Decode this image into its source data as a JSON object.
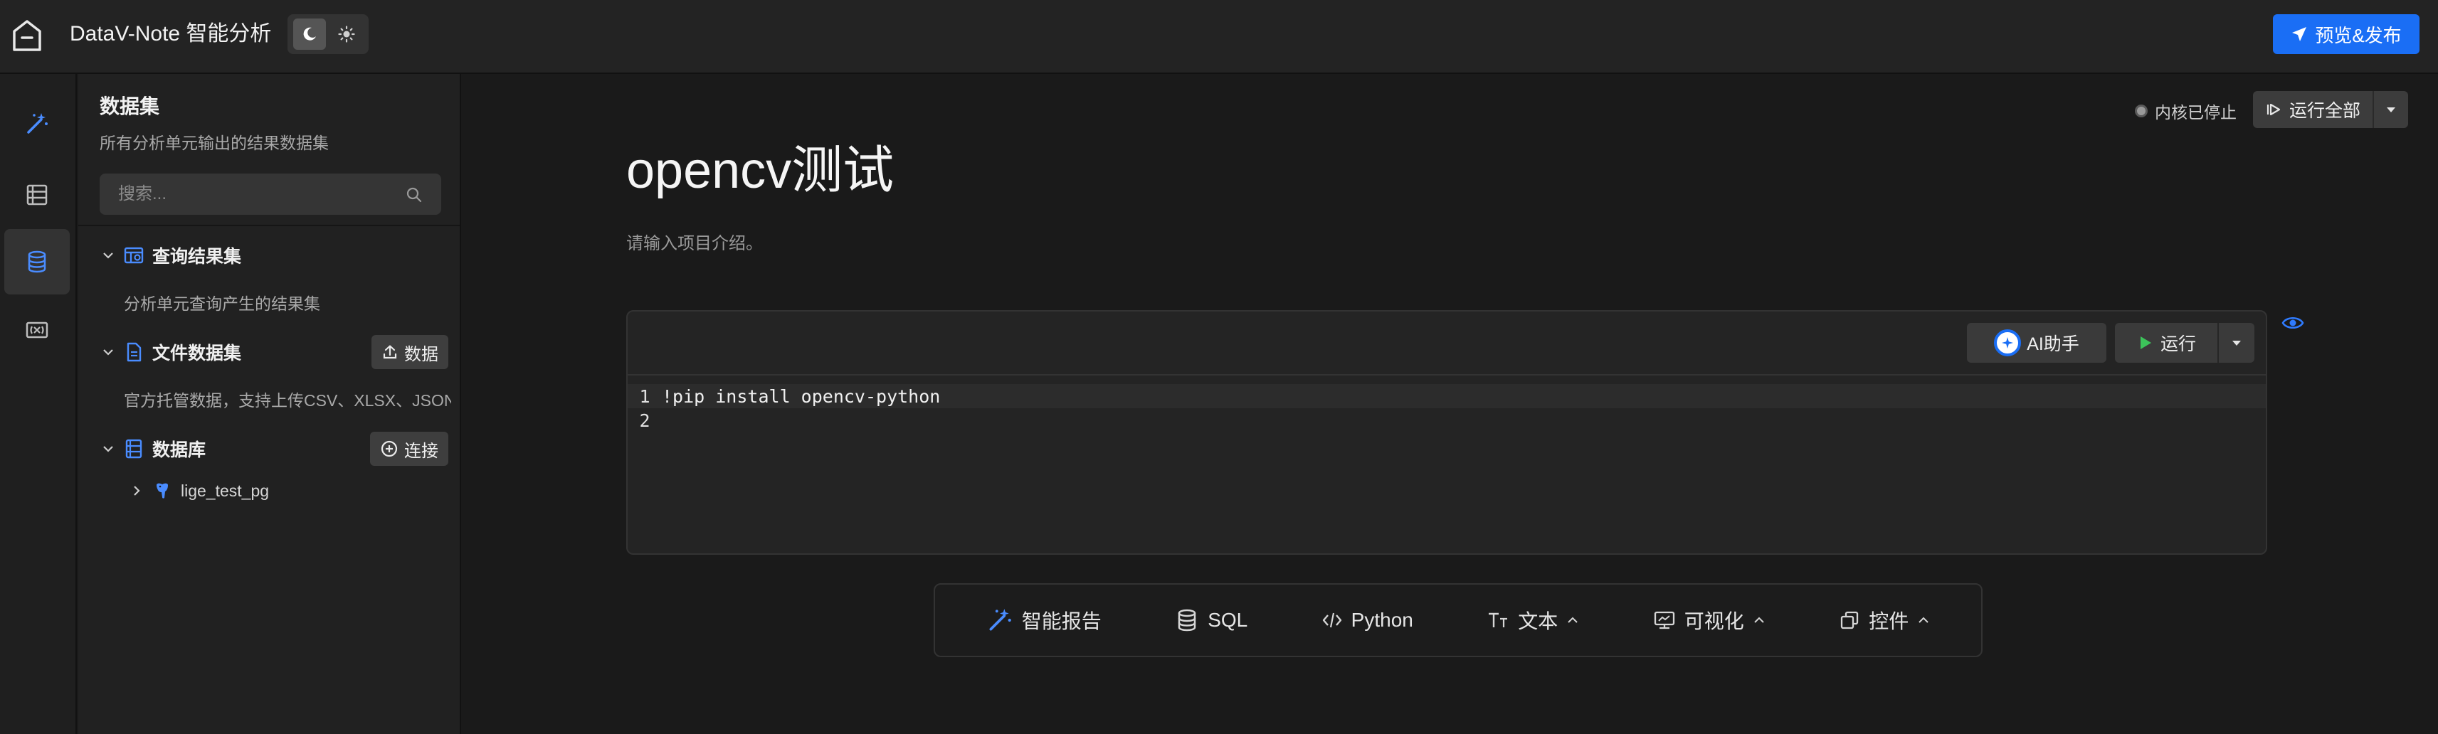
{
  "app": {
    "title": "DataV-Note 智能分析",
    "publish_label": "预览&发布"
  },
  "theme": {
    "selected": "dark"
  },
  "rail": {
    "items": [
      {
        "icon": "magic-wand-icon",
        "active": false
      },
      {
        "icon": "outline-list-icon",
        "active": false
      },
      {
        "icon": "database-icon",
        "active": true
      },
      {
        "icon": "variable-icon",
        "active": false
      }
    ]
  },
  "panel": {
    "title": "数据集",
    "subtitle": "所有分析单元输出的结果数据集",
    "search_placeholder": "搜索...",
    "groups": [
      {
        "label": "查询结果集",
        "description": "分析单元查询产生的结果集"
      },
      {
        "label": "文件数据集",
        "description": "官方托管数据，支持上传CSV、XLSX、JSON",
        "button": "数据"
      },
      {
        "label": "数据库",
        "button": "连接",
        "children": [
          {
            "label": "lige_test_pg"
          }
        ]
      }
    ]
  },
  "main": {
    "kernel_status": "内核已停止",
    "run_all_label": "运行全部",
    "project_title": "opencv测试",
    "project_desc_placeholder": "请输入项目介绍。",
    "cell": {
      "ai_label": "AI助手",
      "run_label": "运行",
      "lines": [
        {
          "no": "1",
          "text": "!pip install opencv-python"
        },
        {
          "no": "2",
          "text": ""
        }
      ]
    },
    "add_bar": [
      {
        "icon": "magic-wand-icon",
        "label": "智能报告"
      },
      {
        "icon": "database-icon",
        "label": "SQL"
      },
      {
        "icon": "code-icon",
        "label": "Python"
      },
      {
        "icon": "text-icon",
        "label": "文本"
      },
      {
        "icon": "chart-monitor-icon",
        "label": "可视化"
      },
      {
        "icon": "widget-icon",
        "label": "控件"
      }
    ]
  },
  "colors": {
    "accent": "#1a6ef5",
    "run_green": "#3cc35a"
  }
}
